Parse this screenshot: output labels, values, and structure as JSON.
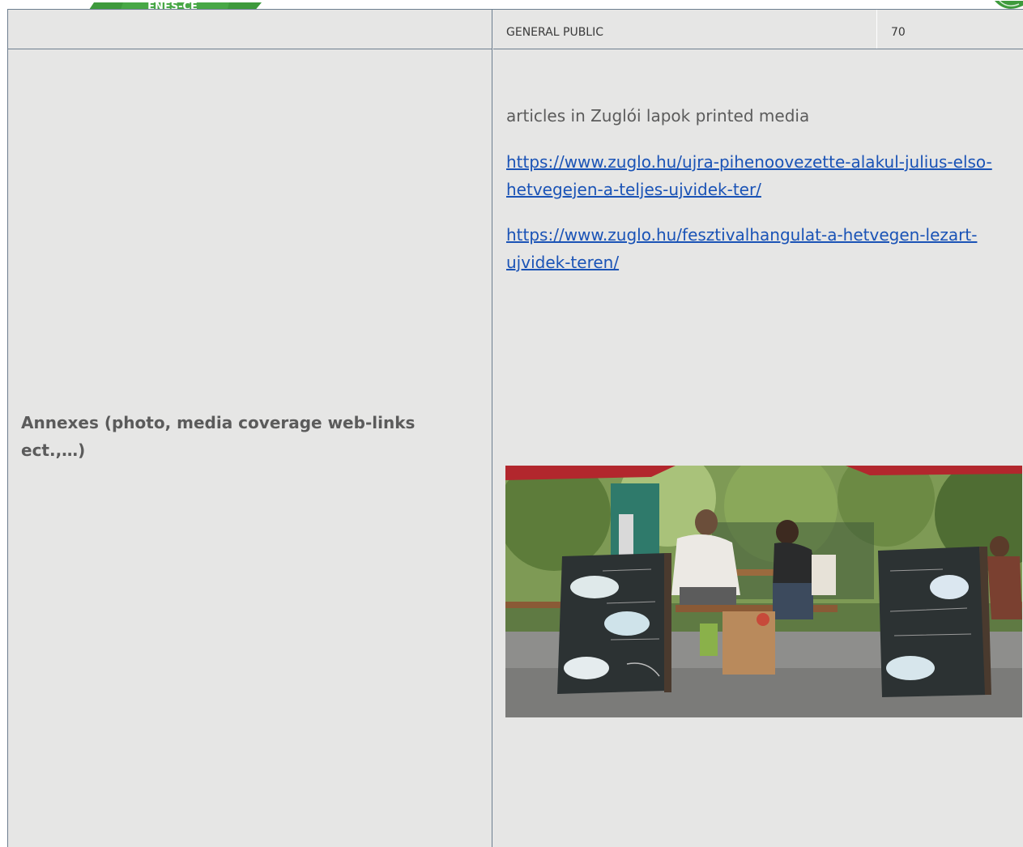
{
  "header": {
    "logo_text": "ENES-CE"
  },
  "table": {
    "audience_row": {
      "label": "GENERAL PUBLIC",
      "count": "70"
    },
    "annexes_row": {
      "label": "Annexes (photo, media coverage web-links ect.,…)",
      "media_heading": "articles in Zuglói lapok printed media",
      "links": [
        "https://www.zuglo.hu/ujra-pihenoovezette-alakul-julius-elso-hetvegejen-a-teljes-ujvidek-ter/",
        "https://www.zuglo.hu/fesztivalhangulat-a-hetvegen-lezart-ujvidek-teren/"
      ],
      "photo_subject": "outdoor-cafe-chalkboards"
    }
  },
  "colors": {
    "cell_background": "#e6e6e5",
    "border": "#6d7e8f",
    "link": "#1a53b6",
    "logo_green": "#3e9a3c"
  }
}
